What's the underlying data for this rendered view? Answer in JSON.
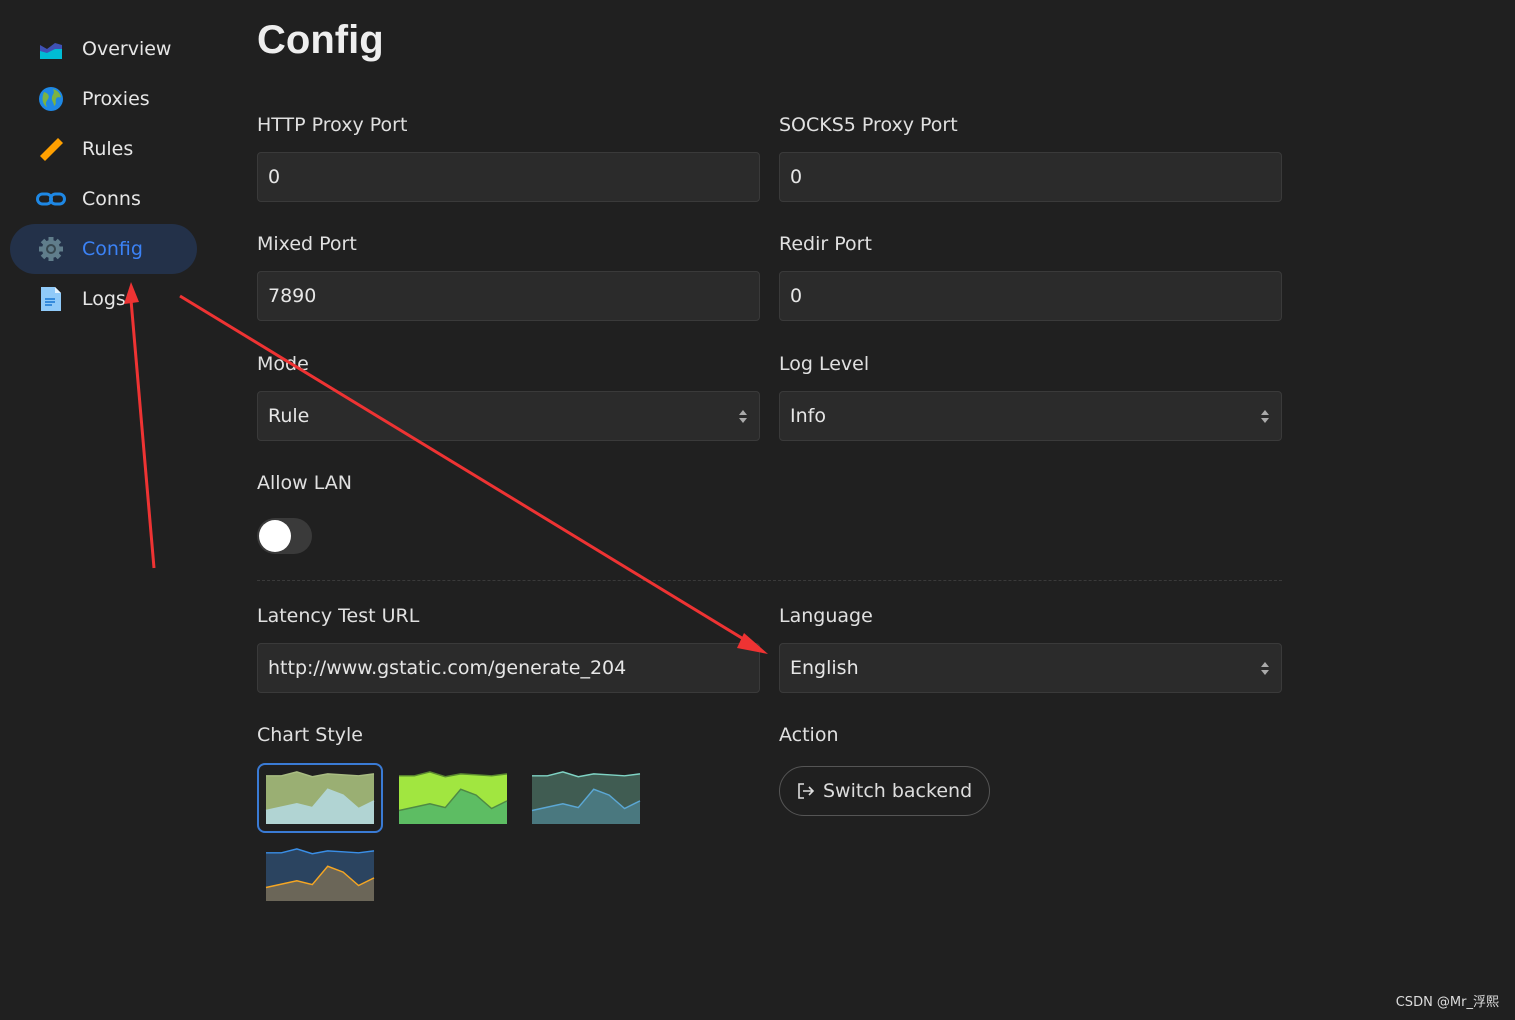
{
  "sidebar": {
    "items": [
      {
        "label": "Overview",
        "icon": "chart-area-icon"
      },
      {
        "label": "Proxies",
        "icon": "globe-icon"
      },
      {
        "label": "Rules",
        "icon": "ruler-icon"
      },
      {
        "label": "Conns",
        "icon": "link-icon"
      },
      {
        "label": "Config",
        "icon": "gear-icon",
        "active": true
      },
      {
        "label": "Logs",
        "icon": "document-icon"
      }
    ]
  },
  "page": {
    "title": "Config"
  },
  "fields": {
    "http_port": {
      "label": "HTTP Proxy Port",
      "value": "0"
    },
    "socks_port": {
      "label": "SOCKS5 Proxy Port",
      "value": "0"
    },
    "mixed_port": {
      "label": "Mixed Port",
      "value": "7890"
    },
    "redir_port": {
      "label": "Redir Port",
      "value": "0"
    },
    "mode": {
      "label": "Mode",
      "value": "Rule"
    },
    "log_level": {
      "label": "Log Level",
      "value": "Info"
    },
    "allow_lan": {
      "label": "Allow LAN",
      "value": false
    },
    "latency_url": {
      "label": "Latency Test URL",
      "value": "http://www.gstatic.com/generate_204"
    },
    "language": {
      "label": "Language",
      "value": "English"
    },
    "chart_style": {
      "label": "Chart Style",
      "selected": 0,
      "styles": [
        {
          "fill1": "#9aaf73",
          "line1": "#a9bd82",
          "fill2": "#b1d4d3",
          "line2": "#b1d4d3"
        },
        {
          "fill1": "#a1e640",
          "line1": "#5b8a30",
          "fill2": "#5dbd63",
          "line2": "#4f8a45"
        },
        {
          "fill1": "#405c52",
          "line1": "#7fd3c4",
          "fill2": "#4a787f",
          "line2": "#5ba7d4"
        },
        {
          "fill1": "#2b4460",
          "line1": "#3a8ee6",
          "fill2": "#6b6658",
          "line2": "#f5a623"
        }
      ]
    },
    "action": {
      "label": "Action",
      "button": "Switch backend",
      "icon": "sign-out-icon"
    }
  },
  "annotation_color": "#ee3333",
  "watermark": "CSDN @Mr_浮熙"
}
